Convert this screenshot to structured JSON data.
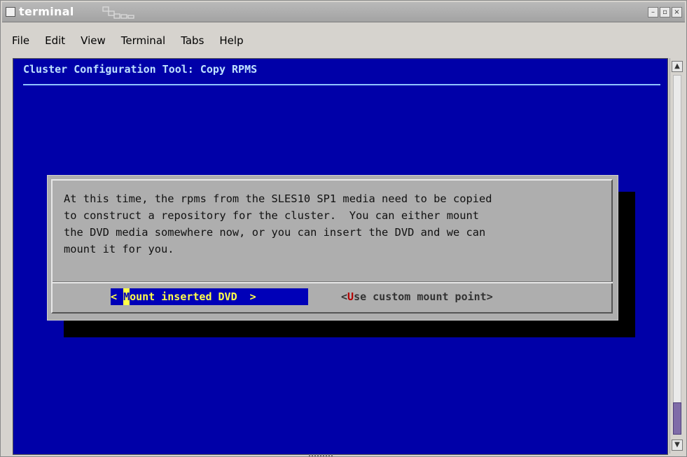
{
  "window": {
    "title": "terminal",
    "controls": [
      "–",
      "▫",
      "×"
    ]
  },
  "menu": {
    "items": [
      "File",
      "Edit",
      "View",
      "Terminal",
      "Tabs",
      "Help"
    ]
  },
  "terminal": {
    "title": "Cluster Configuration Tool: Copy RPMS",
    "dialog": {
      "message": "At this time, the rpms from the SLES10 SP1 media need to be copied\nto construct a repository for the cluster.  You can either mount\nthe DVD media somewhere now, or you can insert the DVD and we can\nmount it for you.",
      "buttons": {
        "mount": {
          "left": "< ",
          "cursor": "M",
          "rest": "ount inserted DVD  >"
        },
        "custom": {
          "left": "<",
          "hot": "U",
          "rest": "se custom mount point>"
        }
      }
    },
    "colors": {
      "background": "#0000a8",
      "dialog": "#aeaeae",
      "title": "#bfe2ff",
      "selected_button_bg": "#0000b8",
      "selected_button_fg": "#ffff4a"
    }
  },
  "scrollbar": {
    "position": 0.95
  }
}
